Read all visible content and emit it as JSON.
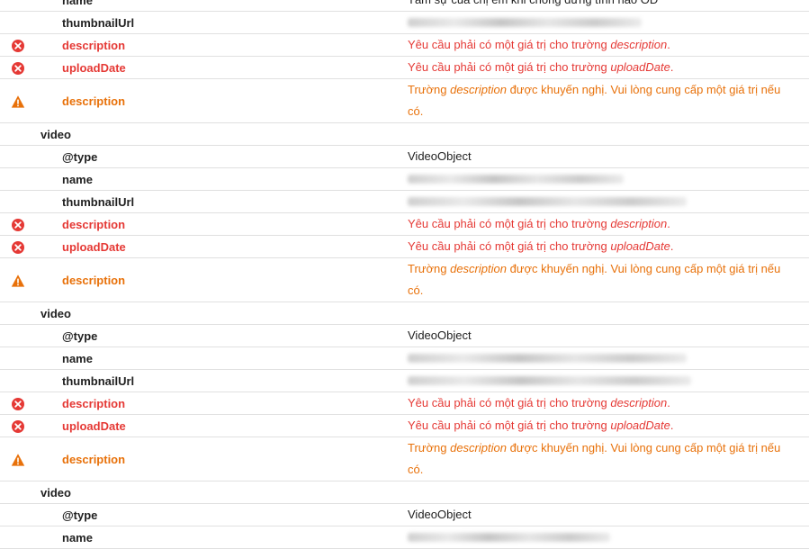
{
  "rows": [
    {
      "kind": "prop",
      "level": 2,
      "label": "name",
      "value": "Tâm sự của chị em khi chồng đứng tình hảo OD",
      "redacted": false
    },
    {
      "kind": "prop",
      "level": 2,
      "label": "thumbnailUrl",
      "redacted": true,
      "redactWidth": 260
    },
    {
      "kind": "error",
      "label": "description",
      "before": "Yêu cầu phải có một giá trị cho trường ",
      "field": "description",
      "after": "."
    },
    {
      "kind": "error",
      "label": "uploadDate",
      "before": "Yêu cầu phải có một giá trị cho trường ",
      "field": "uploadDate",
      "after": "."
    },
    {
      "kind": "warning",
      "label": "description",
      "before": "Trường ",
      "field": "description",
      "after": " được khuyến nghị. Vui lòng cung cấp một giá trị nếu có."
    },
    {
      "kind": "section",
      "level": 1,
      "label": "video"
    },
    {
      "kind": "prop",
      "level": 2,
      "label": "@type",
      "value": "VideoObject"
    },
    {
      "kind": "prop",
      "level": 2,
      "label": "name",
      "redacted": true,
      "redactWidth": 240
    },
    {
      "kind": "prop",
      "level": 2,
      "label": "thumbnailUrl",
      "redacted": true,
      "redactWidth": 310
    },
    {
      "kind": "error",
      "label": "description",
      "before": "Yêu cầu phải có một giá trị cho trường ",
      "field": "description",
      "after": "."
    },
    {
      "kind": "error",
      "label": "uploadDate",
      "before": "Yêu cầu phải có một giá trị cho trường ",
      "field": "uploadDate",
      "after": "."
    },
    {
      "kind": "warning",
      "label": "description",
      "before": "Trường ",
      "field": "description",
      "after": " được khuyến nghị. Vui lòng cung cấp một giá trị nếu có."
    },
    {
      "kind": "section",
      "level": 1,
      "label": "video"
    },
    {
      "kind": "prop",
      "level": 2,
      "label": "@type",
      "value": "VideoObject"
    },
    {
      "kind": "prop",
      "level": 2,
      "label": "name",
      "redacted": true,
      "redactWidth": 310
    },
    {
      "kind": "prop",
      "level": 2,
      "label": "thumbnailUrl",
      "redacted": true,
      "redactWidth": 315
    },
    {
      "kind": "error",
      "label": "description",
      "before": "Yêu cầu phải có một giá trị cho trường ",
      "field": "description",
      "after": "."
    },
    {
      "kind": "error",
      "label": "uploadDate",
      "before": "Yêu cầu phải có một giá trị cho trường ",
      "field": "uploadDate",
      "after": "."
    },
    {
      "kind": "warning",
      "label": "description",
      "before": "Trường ",
      "field": "description",
      "after": " được khuyến nghị. Vui lòng cung cấp một giá trị nếu có."
    },
    {
      "kind": "section",
      "level": 1,
      "label": "video"
    },
    {
      "kind": "prop",
      "level": 2,
      "label": "@type",
      "value": "VideoObject"
    },
    {
      "kind": "prop",
      "level": 2,
      "label": "name",
      "redacted": true,
      "redactWidth": 225
    }
  ],
  "icons": {
    "error": {
      "name": "error-icon",
      "color": "#e53935"
    },
    "warning": {
      "name": "warning-icon",
      "color": "#e8710a"
    }
  }
}
